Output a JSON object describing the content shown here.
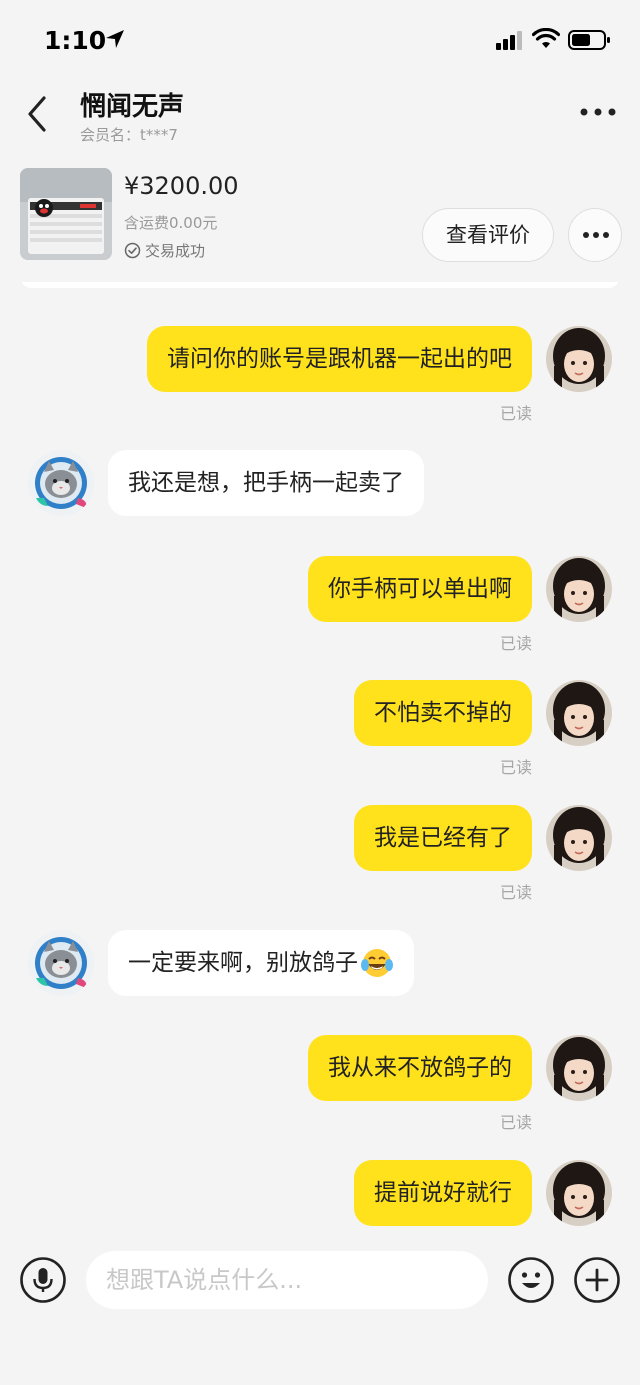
{
  "status_bar": {
    "time": "1:10"
  },
  "header": {
    "title": "惘闻无声",
    "member": "会员名：t***7"
  },
  "product": {
    "price": "¥3200.00",
    "shipping": "含运费0.00元",
    "status": "交易成功",
    "review_button": "查看评价"
  },
  "messages": [
    {
      "from": "me",
      "text": "请问你的账号是跟机器一起出的吧",
      "read": "已读"
    },
    {
      "from": "them",
      "text": "我还是想，把手柄一起卖了"
    },
    {
      "from": "me",
      "text": "你手柄可以单出啊",
      "read": "已读"
    },
    {
      "from": "me",
      "text": "不怕卖不掉的",
      "read": "已读"
    },
    {
      "from": "me",
      "text": "我是已经有了",
      "read": "已读"
    },
    {
      "from": "them",
      "text": "一定要来啊，别放鸽子"
    },
    {
      "from": "me",
      "text": "我从来不放鸽子的",
      "read": "已读"
    },
    {
      "from": "me",
      "text": "提前说好就行"
    }
  ],
  "input": {
    "placeholder": "想跟TA说点什么..."
  },
  "colors": {
    "my_bubble": "#ffe21c",
    "their_bubble": "#ffffff",
    "background": "#f4f4f4"
  }
}
